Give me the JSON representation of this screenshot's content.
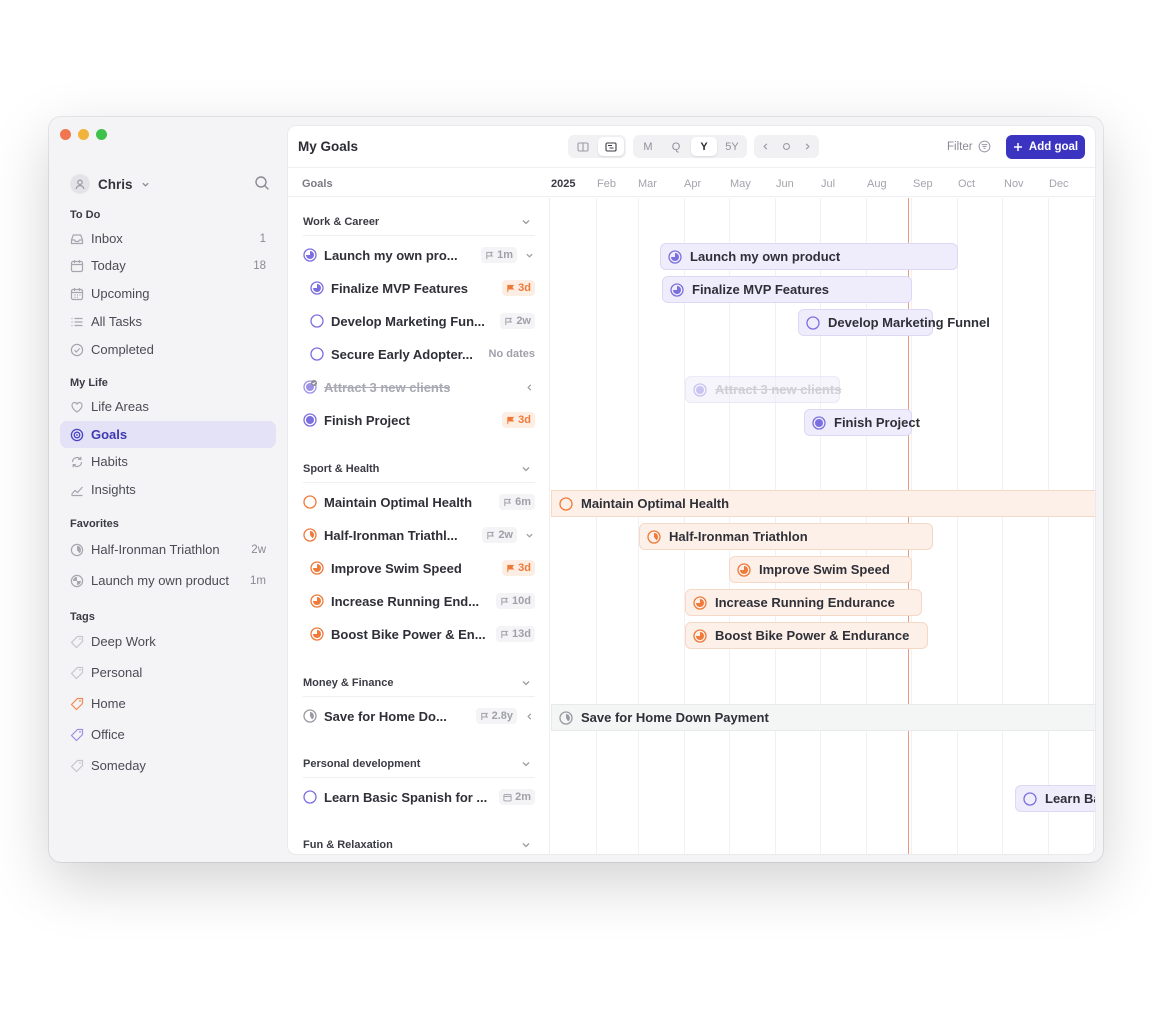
{
  "user": {
    "name": "Chris"
  },
  "sidebar": {
    "todo_title": "To Do",
    "todo": [
      {
        "label": "Inbox",
        "count": "1",
        "icon": "inbox-icon"
      },
      {
        "label": "Today",
        "count": "18",
        "icon": "calendar-icon"
      },
      {
        "label": "Upcoming",
        "count": "",
        "icon": "calendar-grid-icon"
      },
      {
        "label": "All Tasks",
        "count": "",
        "icon": "list-icon"
      },
      {
        "label": "Completed",
        "count": "",
        "icon": "check-circle-icon"
      }
    ],
    "mylife_title": "My Life",
    "mylife": [
      {
        "label": "Life Areas",
        "icon": "heart-icon"
      },
      {
        "label": "Goals",
        "icon": "target-icon"
      },
      {
        "label": "Habits",
        "icon": "repeat-icon"
      },
      {
        "label": "Insights",
        "icon": "chart-line-icon"
      }
    ],
    "favorites_title": "Favorites",
    "favorites": [
      {
        "label": "Half-Ironman Triathlon",
        "count": "2w"
      },
      {
        "label": "Launch my own product",
        "count": "1m"
      }
    ],
    "tags_title": "Tags",
    "tags": [
      {
        "label": "Deep Work",
        "color": "#c6c6ce"
      },
      {
        "label": "Personal",
        "color": "#c6c6ce"
      },
      {
        "label": "Home",
        "color": "#f08a52"
      },
      {
        "label": "Office",
        "color": "#9c8fe8"
      },
      {
        "label": "Someday",
        "color": "#c6c6ce"
      }
    ]
  },
  "header": {
    "title": "My Goals",
    "scales": [
      "M",
      "Q",
      "Y",
      "5Y"
    ],
    "active_scale": "Y",
    "filter_label": "Filter",
    "add_label": "Add goal"
  },
  "timeline": {
    "goals_label": "Goals",
    "year": "2025",
    "months": [
      "Feb",
      "Mar",
      "Apr",
      "May",
      "Jun",
      "Jul",
      "Aug",
      "Sep",
      "Oct",
      "Nov",
      "Dec"
    ]
  },
  "groups": [
    {
      "name": "Work & Career"
    },
    {
      "name": "Sport & Health"
    },
    {
      "name": "Money & Finance"
    },
    {
      "name": "Personal development"
    },
    {
      "name": "Fun & Relaxation"
    }
  ],
  "goals": [
    {
      "label": "Launch my own pro...",
      "meta": "1m",
      "bar": "Launch my own product"
    },
    {
      "label": "Finalize MVP Features",
      "meta": "3d",
      "bar": "Finalize MVP Features"
    },
    {
      "label": "Develop Marketing Fun...",
      "meta": "2w",
      "bar": "Develop Marketing Funnel"
    },
    {
      "label": "Secure Early Adopter...",
      "meta": "No dates"
    },
    {
      "label": "Attract 3 new clients",
      "meta": "",
      "bar": "Attract 3 new clients"
    },
    {
      "label": "Finish Project",
      "meta": "3d",
      "bar": "Finish Project"
    },
    {
      "label": "Maintain Optimal Health",
      "meta": "6m",
      "bar": "Maintain Optimal Health"
    },
    {
      "label": "Half-Ironman Triathl...",
      "meta": "2w",
      "bar": "Half-Ironman Triathlon"
    },
    {
      "label": "Improve Swim Speed",
      "meta": "3d",
      "bar": "Improve Swim Speed"
    },
    {
      "label": "Increase Running End...",
      "meta": "10d",
      "bar": "Increase Running Endurance"
    },
    {
      "label": "Boost Bike Power & En...",
      "meta": "13d",
      "bar": "Boost Bike Power & Endurance"
    },
    {
      "label": "Save for Home Do...",
      "meta": "2.8y",
      "bar": "Save for Home Down Payment"
    },
    {
      "label": "Learn Basic Spanish for ...",
      "meta": "2m",
      "bar": "Learn Ba"
    }
  ],
  "colors": {
    "accent": "#3b34c0",
    "purple": "#7b6fe0",
    "orange": "#ef7a3a",
    "gray": "#9a9aa2"
  }
}
